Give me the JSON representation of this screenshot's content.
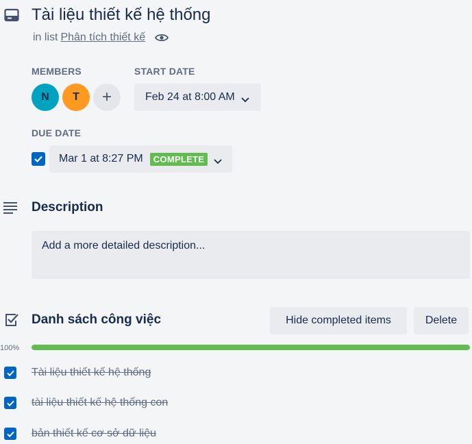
{
  "card": {
    "title": "Tài liệu thiết kế hệ thống",
    "in_list_prefix": "in list",
    "list_name": "Phân tích thiết kế"
  },
  "members": {
    "label": "MEMBERS",
    "avatars": [
      {
        "initial": "N",
        "color": "#00a3bf"
      },
      {
        "initial": "T",
        "color": "#ff991f"
      }
    ],
    "add_symbol": "+"
  },
  "start_date": {
    "label": "START DATE",
    "value": "Feb 24 at 8:00 AM"
  },
  "due_date": {
    "label": "DUE DATE",
    "checked": true,
    "value": "Mar 1 at 8:27 PM",
    "status": "COMPLETE"
  },
  "description": {
    "title": "Description",
    "placeholder": "Add a more detailed description..."
  },
  "checklist": {
    "title": "Danh sách công việc",
    "hide_completed_label": "Hide completed items",
    "delete_label": "Delete",
    "progress_label": "100%",
    "progress": 1.0,
    "items": [
      {
        "text": "Tài liệu thiết kế hệ thống",
        "checked": true
      },
      {
        "text": "tài liệu thiết kế hệ thống con",
        "checked": true
      },
      {
        "text": "bản thiết kế cơ sở dữ liệu",
        "checked": true
      }
    ]
  },
  "colors": {
    "accent": "#0065c2",
    "complete": "#61bd4f",
    "background": "#f4f5f7"
  },
  "icons": [
    "card-icon",
    "eye-icon",
    "plus-icon",
    "chevron-down-icon",
    "check-icon",
    "description-icon",
    "checklist-icon"
  ]
}
